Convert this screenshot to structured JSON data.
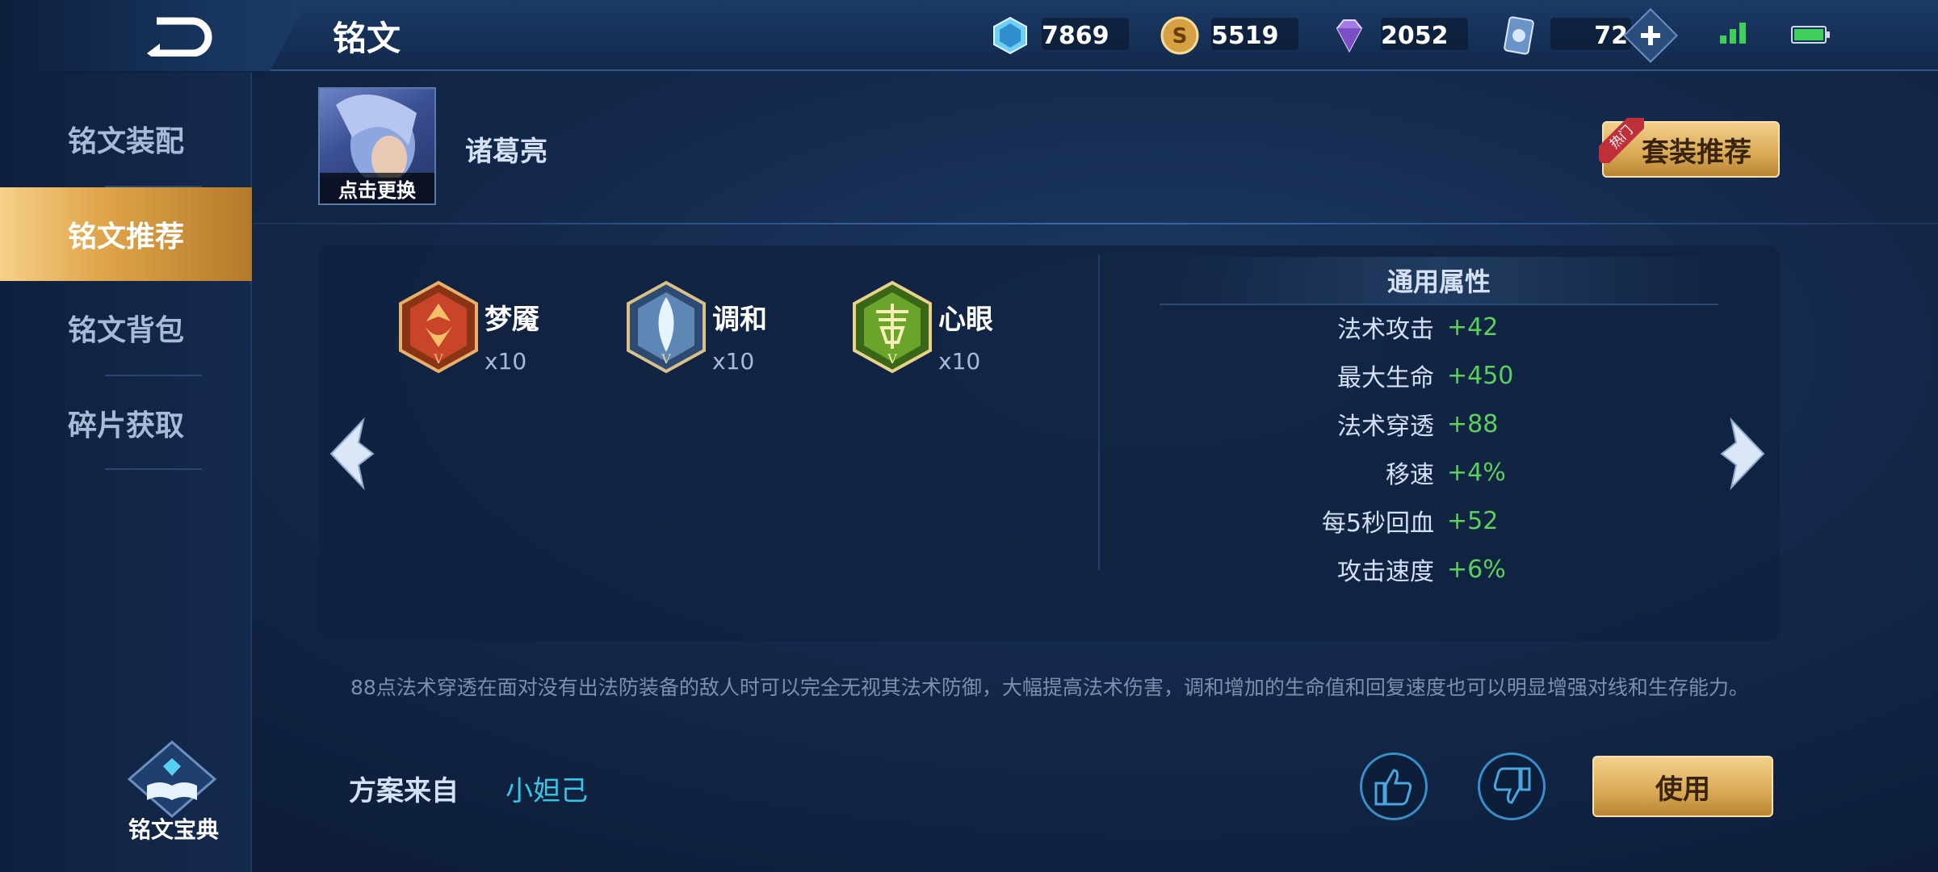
{
  "header": {
    "title": "铭文",
    "currencies": [
      {
        "icon": "crystal-icon",
        "value": "7869"
      },
      {
        "icon": "gold-coin-icon",
        "value": "5519"
      },
      {
        "icon": "diamond-icon",
        "value": "2052"
      },
      {
        "icon": "voucher-card-icon",
        "value": "72"
      }
    ]
  },
  "sidebar": {
    "items": [
      {
        "label": "铭文装配",
        "active": false
      },
      {
        "label": "铭文推荐",
        "active": true
      },
      {
        "label": "铭文背包",
        "active": false
      },
      {
        "label": "碎片获取",
        "active": false
      }
    ],
    "codex_label": "铭文宝典"
  },
  "hero": {
    "name": "诸葛亮",
    "change_label": "点击更换"
  },
  "recommend_button": {
    "label": "套装推荐",
    "hot_tag": "热门"
  },
  "runes": [
    {
      "name": "梦魇",
      "count": "x10",
      "color": "#c9452a"
    },
    {
      "name": "调和",
      "count": "x10",
      "color": "#5f87b6"
    },
    {
      "name": "心眼",
      "count": "x10",
      "color": "#6aa42a"
    }
  ],
  "attributes": {
    "title": "通用属性",
    "rows": [
      {
        "key": "法术攻击",
        "value": "+42"
      },
      {
        "key": "最大生命",
        "value": "+450"
      },
      {
        "key": "法术穿透",
        "value": "+88"
      },
      {
        "key": "移速",
        "value": "+4%"
      },
      {
        "key": "每5秒回血",
        "value": "+52"
      },
      {
        "key": "攻击速度",
        "value": "+6%"
      }
    ]
  },
  "description": "88点法术穿透在面对没有出法防装备的敌人时可以完全无视其法术防御，大幅提高法术伤害，调和增加的生命值和回复速度也可以明显增强对线和生存能力。",
  "source": {
    "label": "方案来自",
    "value": "小妲己"
  },
  "use_button": {
    "label": "使用"
  },
  "colors": {
    "accent_gold": "#d9a954",
    "positive_green": "#5ad15a",
    "link_cyan": "#38c6e6"
  }
}
